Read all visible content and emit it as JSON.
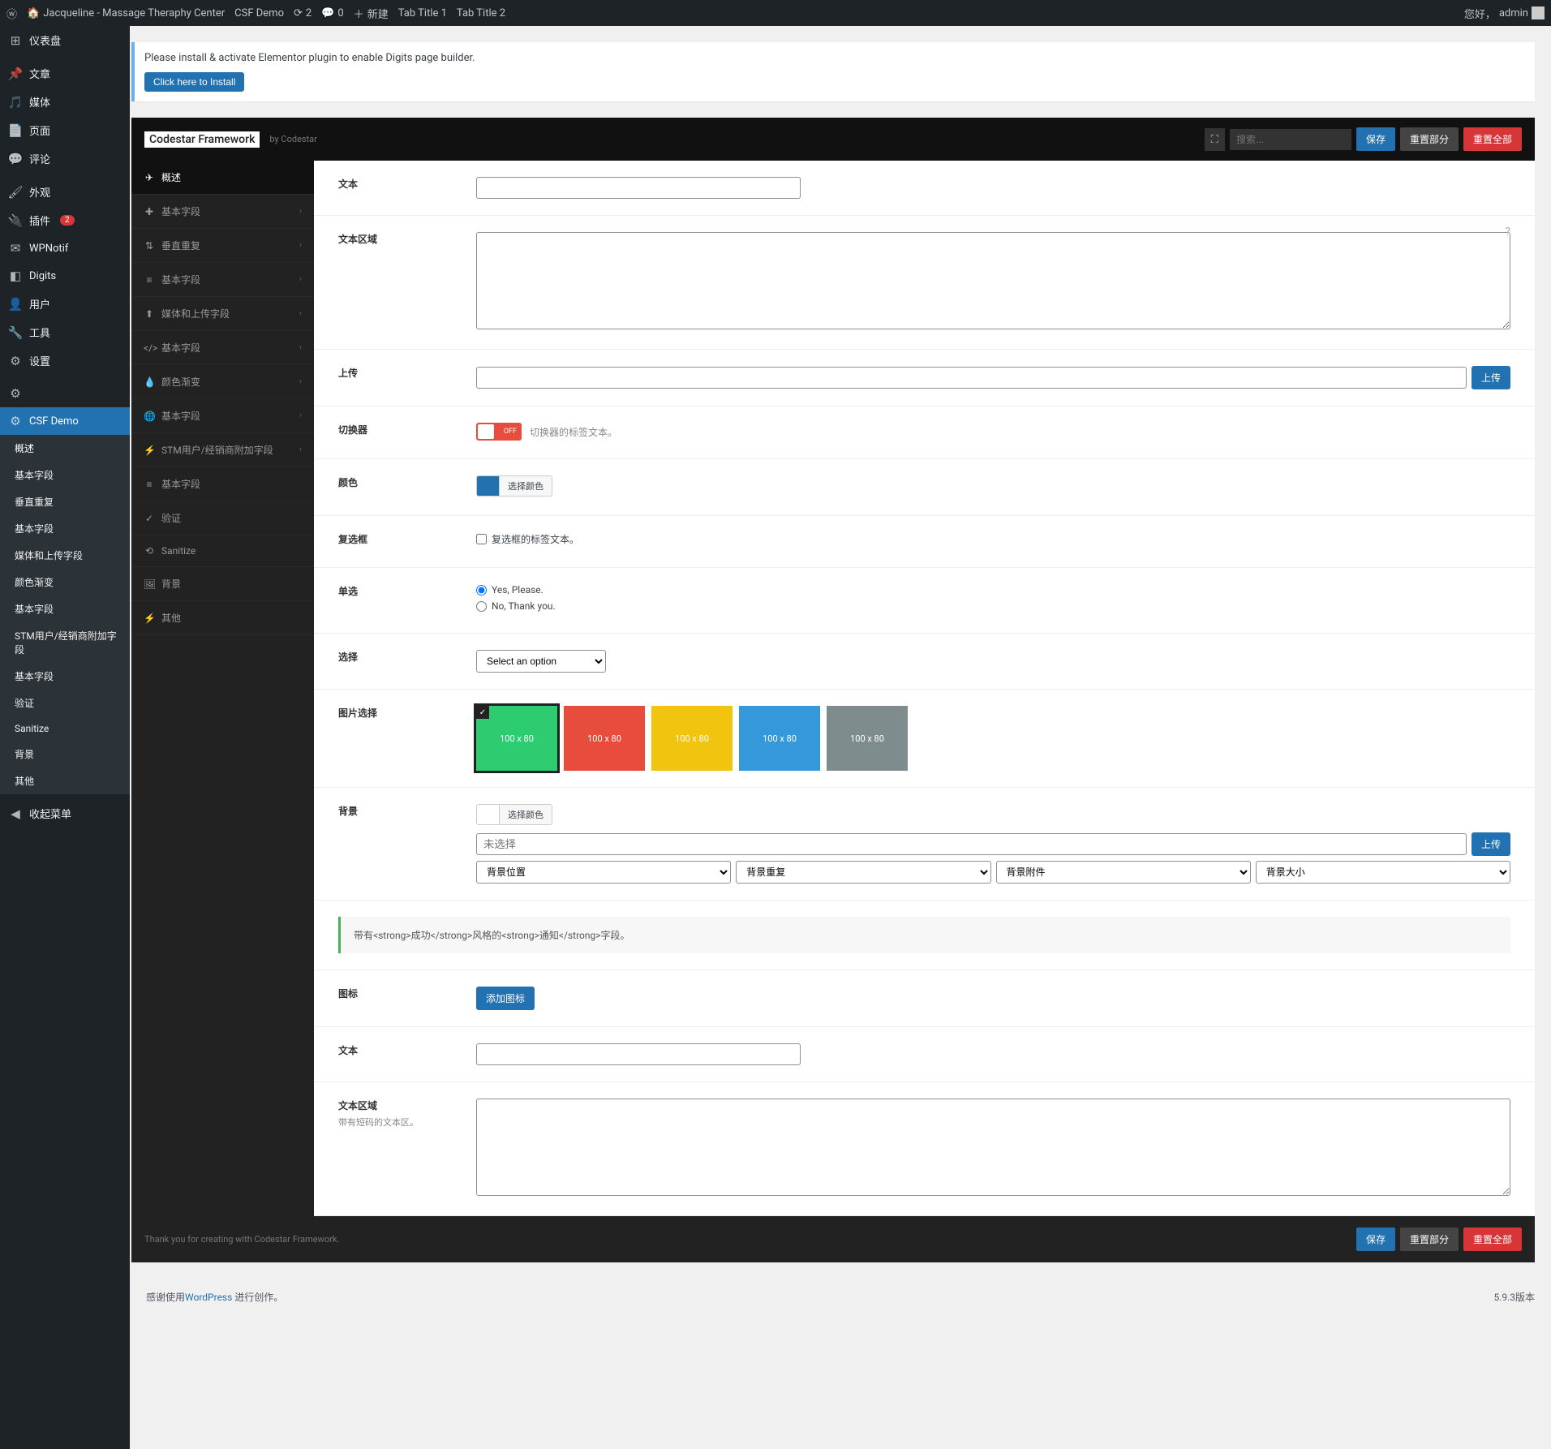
{
  "adminbar": {
    "site_name": "Jacqueline - Massage Theraphy Center",
    "csf_demo": "CSF Demo",
    "updates": "2",
    "comments": "0",
    "new": "新建",
    "tab1": "Tab Title 1",
    "tab2": "Tab Title 2",
    "greeting": "您好，",
    "user": "admin"
  },
  "wp_menu": {
    "dashboard": "仪表盘",
    "posts": "文章",
    "media": "媒体",
    "pages": "页面",
    "comments": "评论",
    "appearance": "外观",
    "plugins": "插件",
    "plugins_count": "2",
    "wpnotif": "WPNotif",
    "digits": "Digits",
    "users": "用户",
    "tools": "工具",
    "settings": "设置",
    "csf_demo": "CSF Demo",
    "sub": {
      "overview": "概述",
      "basic1": "基本字段",
      "repeat": "垂直重复",
      "basic2": "基本字段",
      "media": "媒体和上传字段",
      "gradient": "颜色渐变",
      "basic3": "基本字段",
      "stm": "STM用户/经销商附加字段",
      "basic4": "基本字段",
      "validate": "验证",
      "sanitize": "Sanitize",
      "bg": "背景",
      "other": "其他"
    },
    "collapse": "收起菜单"
  },
  "notice": {
    "text": "Please install & activate Elementor plugin to enable Digits page builder.",
    "btn": "Click here to Install"
  },
  "csf": {
    "logo": "Codestar Framework",
    "by": "by Codestar",
    "search_placeholder": "搜索...",
    "save": "保存",
    "reset": "重置部分",
    "reset_all": "重置全部",
    "nav": [
      "概述",
      "基本字段",
      "垂直重复",
      "基本字段",
      "媒体和上传字段",
      "基本字段",
      "颜色渐变",
      "基本字段",
      "STM用户/经销商附加字段",
      "基本字段",
      "验证",
      "Sanitize",
      "背景",
      "其他"
    ],
    "fields": {
      "text1": "文本",
      "textarea1": "文本区域",
      "upload": "上传",
      "upload_btn": "上传",
      "switch": "切换器",
      "switch_off": "OFF",
      "switch_desc": "切换器的标签文本。",
      "color": "颜色",
      "color_btn": "选择颜色",
      "checkbox": "复选框",
      "checkbox_label": "复选框的标签文本。",
      "radio": "单选",
      "radio1": "Yes, Please.",
      "radio2": "No, Thank you.",
      "select": "选择",
      "select_opt": "Select an option",
      "imgsel": "图片选择",
      "imgtxt": "100 x 80",
      "bg": "背景",
      "bg_nosel": "未选择",
      "bg_pos": "背景位置",
      "bg_rep": "背景重复",
      "bg_att": "背景附件",
      "bg_size": "背景大小",
      "notice_field": "带有<strong>成功</strong>风格的<strong>通知</strong>字段。",
      "icon": "图标",
      "icon_btn": "添加图标",
      "text2": "文本",
      "textarea2": "文本区域",
      "textarea2_desc": "带有短码的文本区。"
    },
    "footer": "Thank you for creating with Codestar Framework."
  },
  "image_colors": [
    "#2ecc71",
    "#e74c3c",
    "#f1c40f",
    "#3498db",
    "#7f8c8d"
  ],
  "wp_footer": {
    "thanks_pre": "感谢使用",
    "wp": "WordPress",
    "thanks_post": " 进行创作。",
    "version": "5.9.3版本"
  }
}
